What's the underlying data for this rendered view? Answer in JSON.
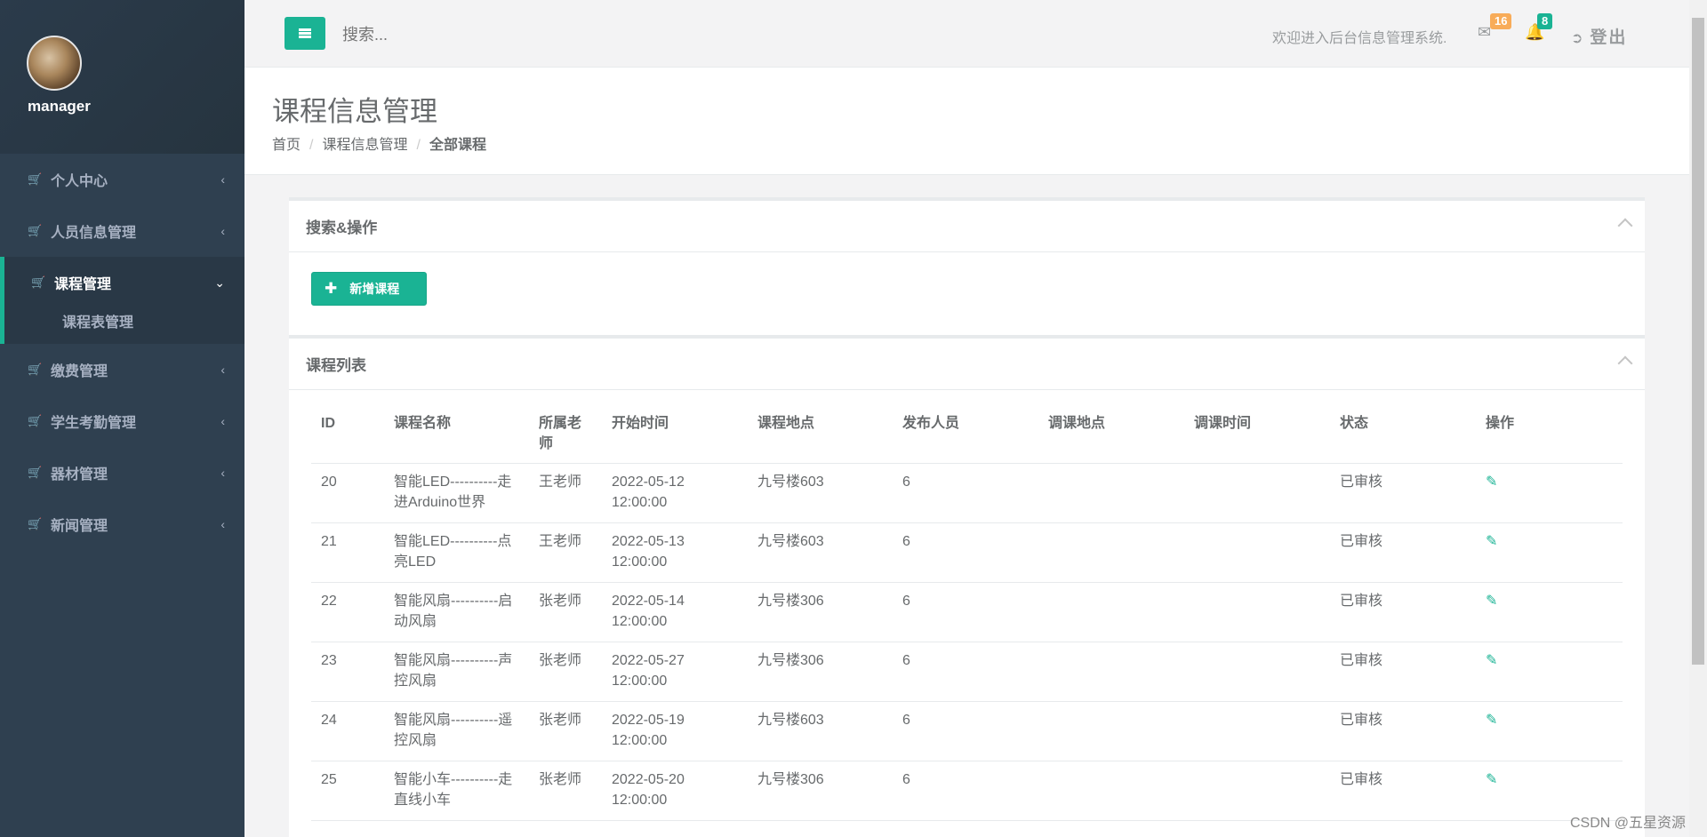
{
  "sidebar": {
    "username": "manager",
    "items": [
      {
        "label": "个人中心"
      },
      {
        "label": "人员信息管理"
      },
      {
        "label": "课程管理",
        "sub": "课程表管理"
      },
      {
        "label": "缴费管理"
      },
      {
        "label": "学生考勤管理"
      },
      {
        "label": "器材管理"
      },
      {
        "label": "新闻管理"
      }
    ]
  },
  "topbar": {
    "search_placeholder": "搜索...",
    "welcome": "欢迎进入后台信息管理系统.",
    "mail_count": "16",
    "notify_count": "8",
    "logout": "登出"
  },
  "heading": {
    "title": "课程信息管理",
    "crumbs": [
      "首页",
      "课程信息管理",
      "全部课程"
    ]
  },
  "search_panel": {
    "title": "搜索&操作",
    "add_button": "新增课程"
  },
  "list_panel": {
    "title": "课程列表",
    "columns": [
      "ID",
      "课程名称",
      "所属老师",
      "开始时间",
      "课程地点",
      "发布人员",
      "调课地点",
      "调课时间",
      "状态",
      "操作"
    ],
    "rows": [
      {
        "id": "20",
        "name": "智能LED----------走进Arduino世界",
        "teacher": "王老师",
        "start": "2022-05-12 12:00:00",
        "place": "九号楼603",
        "publisher": "6",
        "new_place": "",
        "new_time": "",
        "status": "已审核"
      },
      {
        "id": "21",
        "name": "智能LED----------点亮LED",
        "teacher": "王老师",
        "start": "2022-05-13 12:00:00",
        "place": "九号楼603",
        "publisher": "6",
        "new_place": "",
        "new_time": "",
        "status": "已审核"
      },
      {
        "id": "22",
        "name": "智能风扇----------启动风扇",
        "teacher": "张老师",
        "start": "2022-05-14 12:00:00",
        "place": "九号楼306",
        "publisher": "6",
        "new_place": "",
        "new_time": "",
        "status": "已审核"
      },
      {
        "id": "23",
        "name": "智能风扇----------声控风扇",
        "teacher": "张老师",
        "start": "2022-05-27 12:00:00",
        "place": "九号楼306",
        "publisher": "6",
        "new_place": "",
        "new_time": "",
        "status": "已审核"
      },
      {
        "id": "24",
        "name": "智能风扇----------遥控风扇",
        "teacher": "张老师",
        "start": "2022-05-19 12:00:00",
        "place": "九号楼603",
        "publisher": "6",
        "new_place": "",
        "new_time": "",
        "status": "已审核"
      },
      {
        "id": "25",
        "name": "智能小车----------走直线小车",
        "teacher": "张老师",
        "start": "2022-05-20 12:00:00",
        "place": "九号楼306",
        "publisher": "6",
        "new_place": "",
        "new_time": "",
        "status": "已审核"
      }
    ]
  },
  "watermark": "CSDN @五星资源",
  "icons": {
    "menu": "hamburger-icon",
    "cart": "cart-icon",
    "mail": "envelope-icon",
    "bell": "bell-icon",
    "logout": "sign-out-icon",
    "edit": "edit-icon"
  },
  "colors": {
    "accent": "#1ab394",
    "sidebar": "#2f4050",
    "badge_orange": "#f8ac59"
  }
}
